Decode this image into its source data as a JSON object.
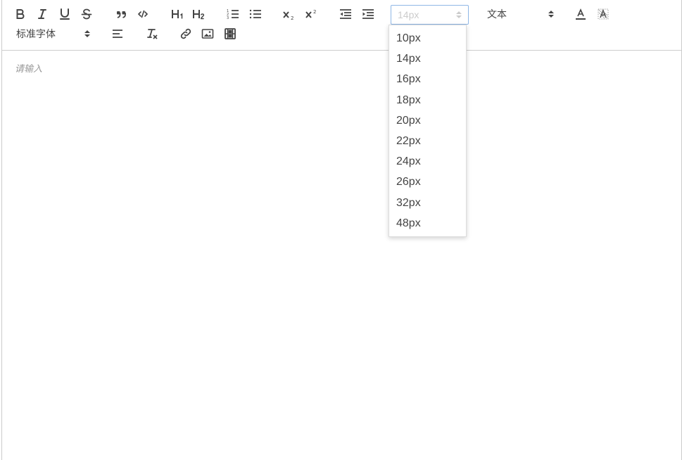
{
  "toolbar": {
    "buttons": [
      {
        "name": "bold-icon",
        "glyph": "B"
      },
      {
        "name": "italic-icon",
        "glyph": "I"
      },
      {
        "name": "underline-icon",
        "glyph": "U"
      },
      {
        "name": "strikethrough-icon",
        "glyph": "S"
      },
      {
        "name": "blockquote-icon",
        "glyph": "quote"
      },
      {
        "name": "code-block-icon",
        "glyph": "code"
      },
      {
        "name": "header-1-icon",
        "glyph": "H1"
      },
      {
        "name": "header-2-icon",
        "glyph": "H2"
      },
      {
        "name": "ordered-list-icon",
        "glyph": "ol"
      },
      {
        "name": "bullet-list-icon",
        "glyph": "ul"
      },
      {
        "name": "subscript-icon",
        "glyph": "sub"
      },
      {
        "name": "superscript-icon",
        "glyph": "sup"
      },
      {
        "name": "outdent-icon",
        "glyph": "outdent"
      },
      {
        "name": "indent-icon",
        "glyph": "indent"
      }
    ],
    "size_picker": {
      "selected": "14px"
    },
    "header_picker": {
      "selected": "文本"
    },
    "font_picker": {
      "selected": "标准字体"
    },
    "color_icon": "text-color-icon",
    "background_icon": "background-color-icon"
  },
  "size_dropdown": {
    "options": [
      "10px",
      "14px",
      "16px",
      "18px",
      "20px",
      "22px",
      "24px",
      "26px",
      "32px",
      "48px"
    ]
  },
  "editor": {
    "placeholder": "请输入"
  }
}
